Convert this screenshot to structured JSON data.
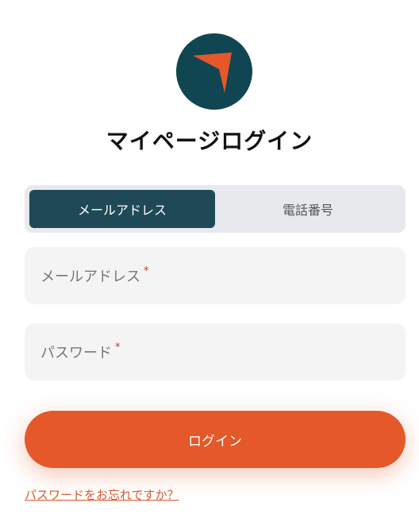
{
  "title": "マイページログイン",
  "logo": {
    "icon": "paper-plane-arrow",
    "bg_color": "#0f4651",
    "accent_color": "#e4582a"
  },
  "tabs": [
    {
      "label": "メールアドレス",
      "active": true
    },
    {
      "label": "電話番号",
      "active": false
    }
  ],
  "fields": {
    "email": {
      "label": "メールアドレス",
      "required_mark": "*"
    },
    "password": {
      "label": "パスワード",
      "required_mark": "*"
    }
  },
  "login_button": {
    "label": "ログイン"
  },
  "forgot_link": {
    "label": "パスワードをお忘れですか？"
  },
  "colors": {
    "primary": "#e4582a",
    "tab_active": "#1f4957",
    "field_bg": "#f4f4f4"
  }
}
